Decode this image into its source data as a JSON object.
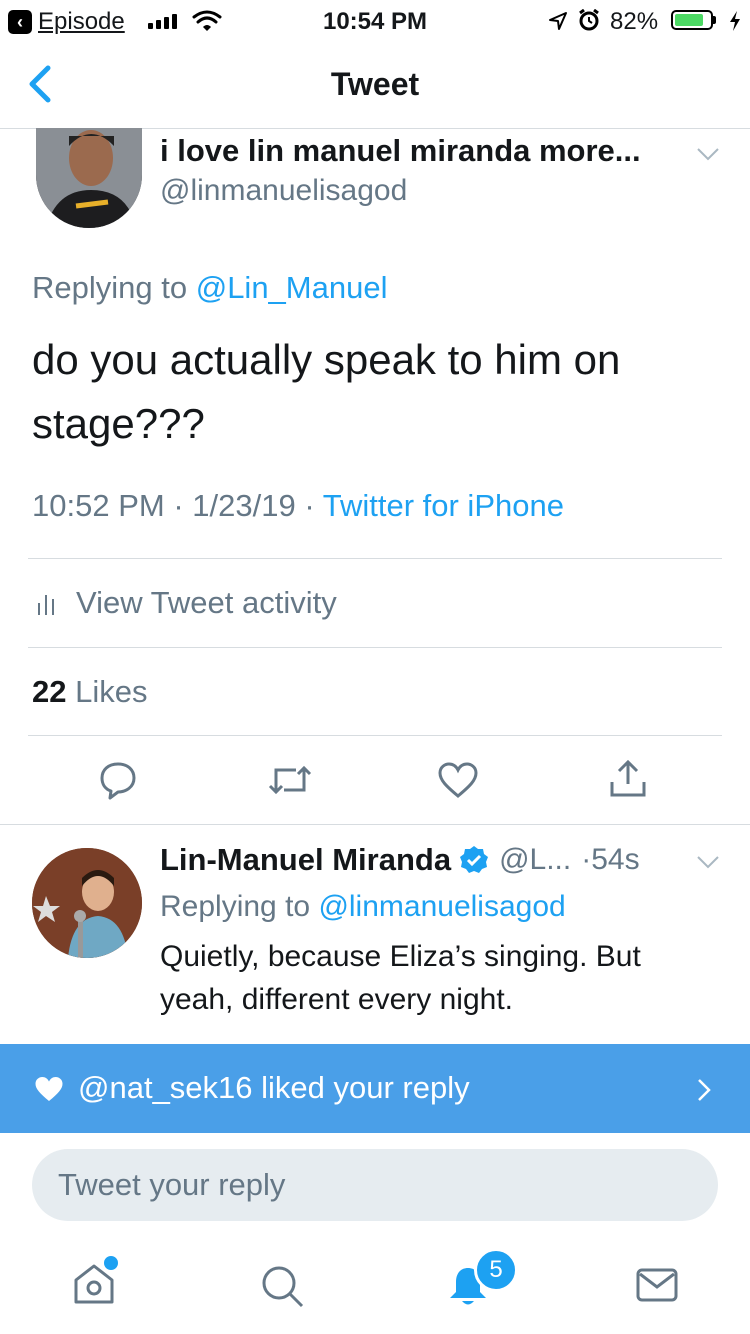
{
  "status_bar": {
    "back_app": "Episode",
    "time": "10:54 PM",
    "battery_pct": "82%",
    "battery_level": 0.82
  },
  "nav": {
    "title": "Tweet"
  },
  "tweet": {
    "author_name": "i love lin manuel miranda more...",
    "author_handle": "@linmanuelisagod",
    "replying_label": "Replying to",
    "replying_to": "@Lin_Manuel",
    "text": "do you actually speak to him on stage???",
    "time": "10:52 PM",
    "date": "1/23/19",
    "sep": "·",
    "source": "Twitter for iPhone",
    "activity_label": "View Tweet activity",
    "likes_count": "22",
    "likes_label": "Likes"
  },
  "reply": {
    "author_name": "Lin-Manuel Miranda",
    "author_handle": "@L...",
    "age": "·54s",
    "replying_label": "Replying to",
    "replying_to": "@linmanuelisagod",
    "text": "Quietly, because Eliza’s singing.  But yeah, different every night."
  },
  "banner": {
    "text": "@nat_sek16 liked your reply"
  },
  "composer": {
    "placeholder": "Tweet your reply"
  },
  "tabbar": {
    "notification_badge": "5"
  },
  "colors": {
    "accent": "#1da1f2",
    "banner": "#4a9fe8",
    "muted": "#657786",
    "battery": "#4cd964"
  },
  "icons": [
    "location-icon",
    "alarm-icon",
    "wifi-icon",
    "signal-icon",
    "back-chevron-icon",
    "chevron-down-icon",
    "verified-icon",
    "activity-icon",
    "reply-icon",
    "retweet-icon",
    "like-icon",
    "share-icon",
    "heart-icon",
    "chevron-right-icon",
    "home-icon",
    "search-icon",
    "bell-icon",
    "mail-icon"
  ]
}
